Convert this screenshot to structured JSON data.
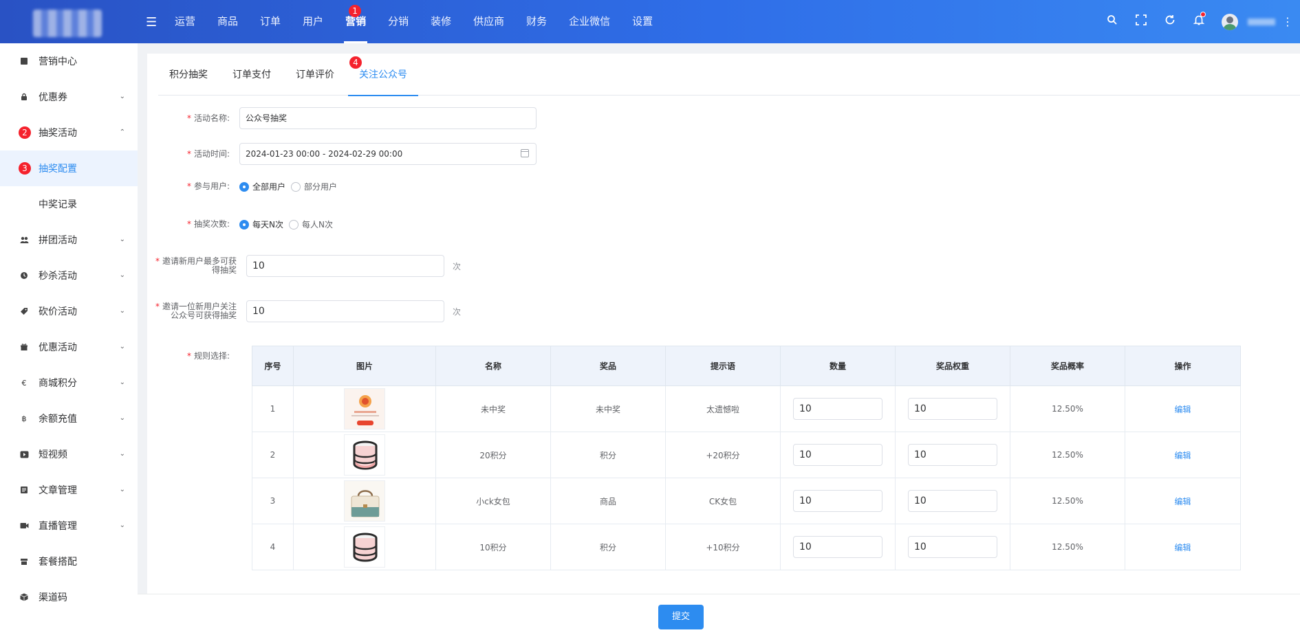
{
  "header": {
    "nav": [
      {
        "label": "运营"
      },
      {
        "label": "商品"
      },
      {
        "label": "订单"
      },
      {
        "label": "用户"
      },
      {
        "label": "营销",
        "badge": "1"
      },
      {
        "label": "分销"
      },
      {
        "label": "装修"
      },
      {
        "label": "供应商"
      },
      {
        "label": "财务"
      },
      {
        "label": "企业微信"
      },
      {
        "label": "设置"
      }
    ],
    "icons": [
      "menu-fold-icon",
      "search-icon",
      "fullscreen-icon",
      "refresh-icon",
      "bell-icon",
      "avatar",
      "more-icon"
    ]
  },
  "sidebar": {
    "items": [
      {
        "label": "营销中心",
        "icon": "marketing-icon"
      },
      {
        "label": "优惠券",
        "icon": "lock-icon"
      },
      {
        "label": "抽奖活动",
        "badge": "2"
      },
      {
        "label": "抽奖配置",
        "badge": "3"
      },
      {
        "label": "中奖记录"
      },
      {
        "label": "拼团活动",
        "icon": "group-icon"
      },
      {
        "label": "秒杀活动",
        "icon": "clock-icon"
      },
      {
        "label": "砍价活动",
        "icon": "tag-icon"
      },
      {
        "label": "优惠活动",
        "icon": "gift-icon"
      },
      {
        "label": "商城积分",
        "icon": "euro-icon"
      },
      {
        "label": "余额充值",
        "icon": "bitcoin-icon"
      },
      {
        "label": "短视频",
        "icon": "video-icon"
      },
      {
        "label": "文章管理",
        "icon": "article-icon"
      },
      {
        "label": "直播管理",
        "icon": "live-icon"
      },
      {
        "label": "套餐搭配",
        "icon": "package-icon"
      },
      {
        "label": "渠道码",
        "icon": "qrcode-icon"
      }
    ]
  },
  "tabs": [
    {
      "label": "积分抽奖"
    },
    {
      "label": "订单支付"
    },
    {
      "label": "订单评价"
    },
    {
      "label": "关注公众号",
      "badge": "4"
    }
  ],
  "form": {
    "activity_name": {
      "label": "活动名称:",
      "value": "公众号抽奖"
    },
    "activity_time": {
      "label": "活动时间:",
      "value": "2024-01-23 00:00 - 2024-02-29 00:00"
    },
    "participants": {
      "label": "参与用户:",
      "options": [
        "全部用户",
        "部分用户"
      ],
      "selected": "全部用户"
    },
    "draw_times": {
      "label": "抽奖次数:",
      "options": [
        "每天N次",
        "每人N次"
      ],
      "selected": "每天N次"
    },
    "invite_max": {
      "label_line1": "邀请新用户最多可获",
      "label_line2": "得抽奖",
      "value": "10",
      "unit": "次"
    },
    "invite_follow": {
      "label_line1": "邀请一位新用户关注",
      "label_line2": "公众号可获得抽奖",
      "value": "10",
      "unit": "次"
    },
    "rules_label": "规则选择:"
  },
  "table": {
    "columns": [
      "序号",
      "图片",
      "名称",
      "奖品",
      "提示语",
      "数量",
      "奖品权重",
      "奖品概率",
      "操作"
    ],
    "rows": [
      {
        "index": "1",
        "image": "no-prize-image",
        "name": "未中奖",
        "prize": "未中奖",
        "tip": "太遗憾啦",
        "quantity": "10",
        "weight": "10",
        "probability": "12.50%",
        "action": "编辑"
      },
      {
        "index": "2",
        "image": "points-coin-image",
        "name": "20积分",
        "prize": "积分",
        "tip": "+20积分",
        "quantity": "10",
        "weight": "10",
        "probability": "12.50%",
        "action": "编辑"
      },
      {
        "index": "3",
        "image": "handbag-image",
        "name": "小ck女包",
        "prize": "商品",
        "tip": "CK女包",
        "quantity": "10",
        "weight": "10",
        "probability": "12.50%",
        "action": "编辑"
      },
      {
        "index": "4",
        "image": "points-coin-image",
        "name": "10积分",
        "prize": "积分",
        "tip": "+10积分",
        "quantity": "10",
        "weight": "10",
        "probability": "12.50%",
        "action": "编辑"
      }
    ]
  },
  "footer": {
    "submit_label": "提交"
  },
  "colors": {
    "primary": "#2d8cf0",
    "header_start": "#2952c4",
    "header_end": "#3a8af2",
    "badge": "#f5222d"
  }
}
